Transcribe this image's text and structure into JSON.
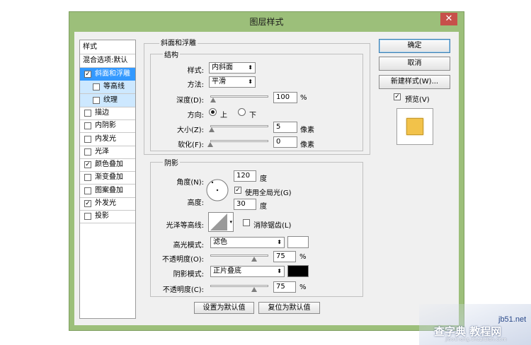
{
  "window": {
    "title": "图层样式",
    "close_glyph": "✕"
  },
  "left_panel": {
    "header": "样式",
    "blend": "混合选项:默认",
    "items": [
      {
        "label": "斜面和浮雕",
        "checked": true,
        "selected": true
      },
      {
        "label": "等高线",
        "checked": false,
        "sub": true
      },
      {
        "label": "纹理",
        "checked": false,
        "sub": true
      },
      {
        "label": "描边",
        "checked": false
      },
      {
        "label": "内阴影",
        "checked": false
      },
      {
        "label": "内发光",
        "checked": false
      },
      {
        "label": "光泽",
        "checked": false
      },
      {
        "label": "颜色叠加",
        "checked": true
      },
      {
        "label": "渐变叠加",
        "checked": false
      },
      {
        "label": "图案叠加",
        "checked": false
      },
      {
        "label": "外发光",
        "checked": true
      },
      {
        "label": "投影",
        "checked": false
      }
    ]
  },
  "bevel": {
    "title": "斜面和浮雕",
    "structure": "结构",
    "style_label": "样式:",
    "style_value": "内斜面",
    "method_label": "方法:",
    "method_value": "平滑",
    "depth_label": "深度(D):",
    "depth_value": "100",
    "depth_unit": "%",
    "depth_pos": 0.05,
    "direction_label": "方向:",
    "dir_up": "上",
    "dir_down": "下",
    "size_label": "大小(Z):",
    "size_value": "5",
    "size_unit": "像素",
    "size_pos": 0.03,
    "soften_label": "软化(F):",
    "soften_value": "0",
    "soften_unit": "像素",
    "soften_pos": 0.0
  },
  "shading": {
    "title": "阴影",
    "angle_label": "角度(N):",
    "angle_value": "120",
    "angle_unit": "度",
    "global_light": "使用全局光(G)",
    "altitude_label": "高度:",
    "altitude_value": "30",
    "altitude_unit": "度",
    "gloss_label": "光泽等高线:",
    "antialias": "消除锯齿(L)",
    "highlight_label": "高光模式:",
    "highlight_value": "滤色",
    "highlight_color": "#ffffff",
    "opacity1_label": "不透明度(O):",
    "opacity1_value": "75",
    "opacity1_unit": "%",
    "opacity1_pos": 0.75,
    "shadow_label": "阴影模式:",
    "shadow_value": "正片叠底",
    "shadow_color": "#000000",
    "opacity2_label": "不透明度(C):",
    "opacity2_value": "75",
    "opacity2_unit": "%",
    "opacity2_pos": 0.75
  },
  "footer": {
    "make_default": "设置为默认值",
    "reset_default": "复位为默认值"
  },
  "right": {
    "ok": "确定",
    "cancel": "取消",
    "new_style": "新建样式(W)...",
    "preview": "预览(V)",
    "swatch_color": "#f2c24a"
  },
  "watermark": {
    "site": "jb51.net",
    "text": "查字典 教程网",
    "url": "jiaocheng.chazidian.com"
  }
}
